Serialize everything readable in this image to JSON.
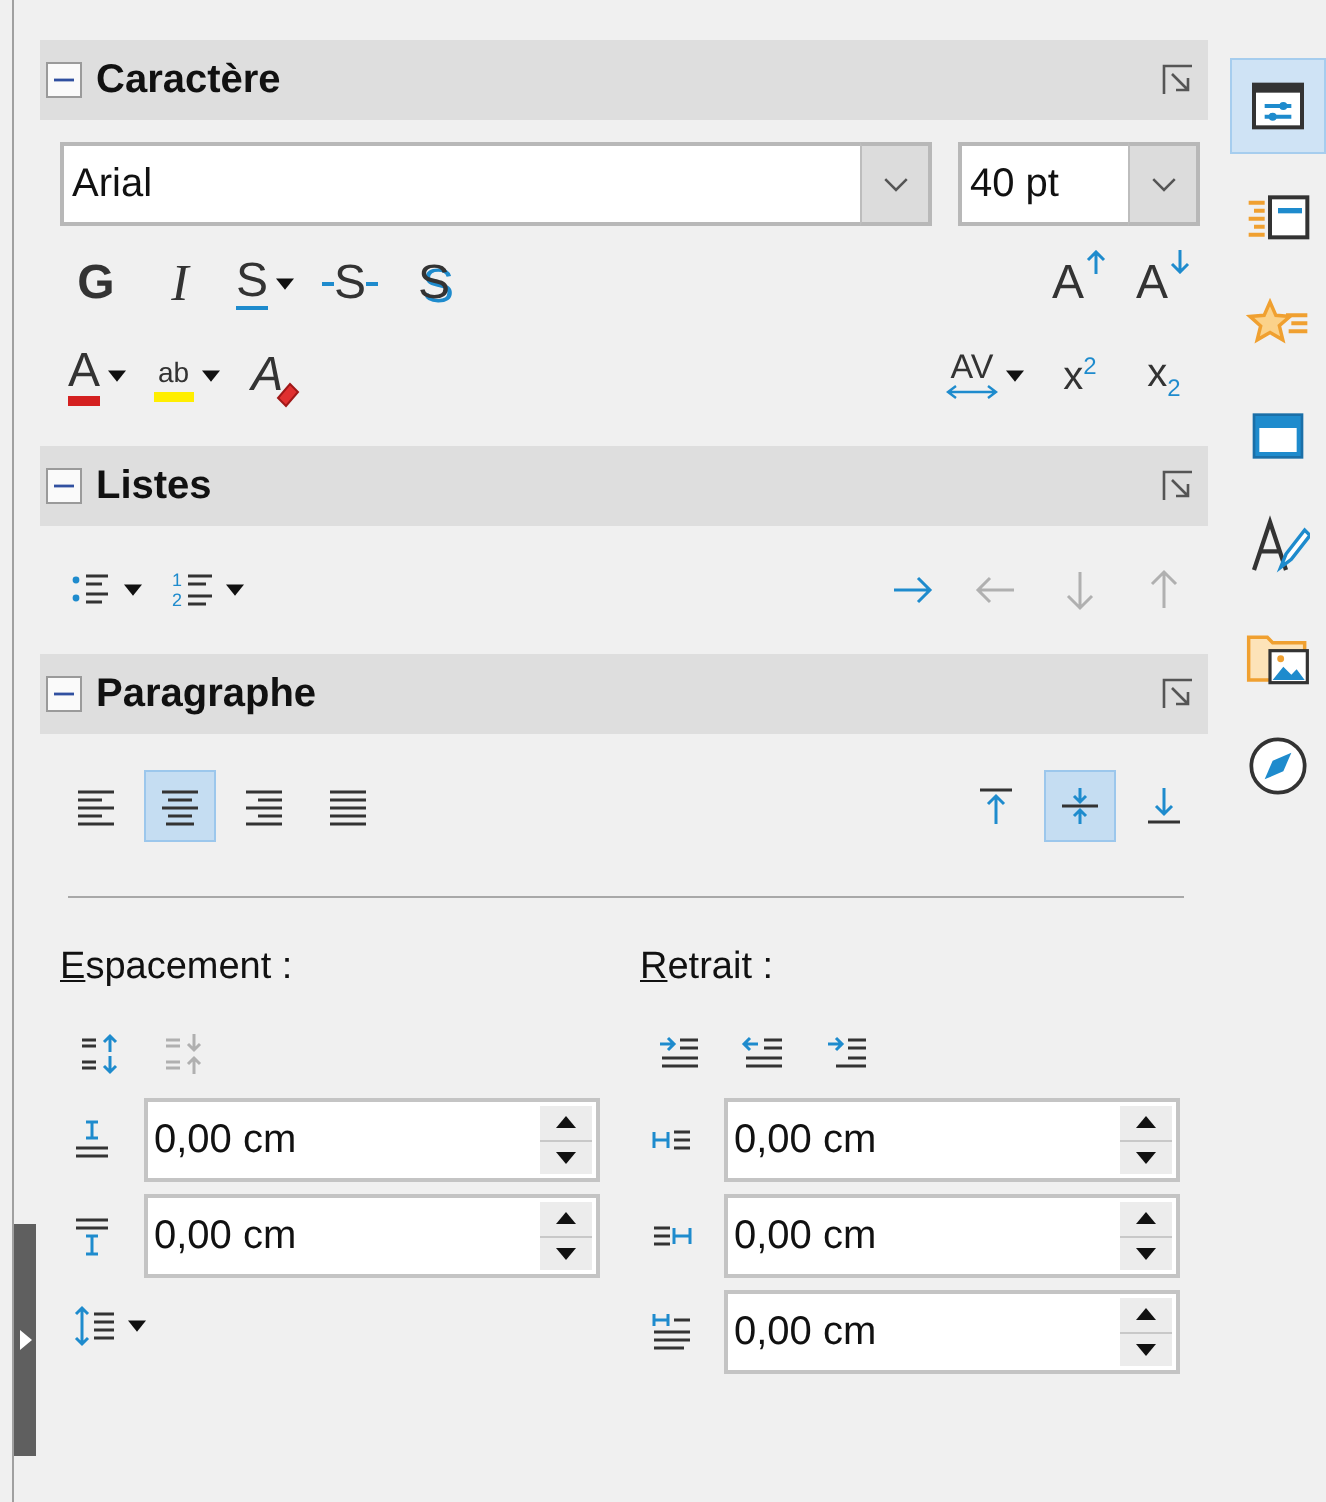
{
  "character": {
    "title": "Caractère",
    "expanded": true,
    "font_name": {
      "value": "Arial"
    },
    "font_size": {
      "value": "40 pt"
    },
    "format_tools": [
      {
        "kind": "bold",
        "label": "G"
      },
      {
        "kind": "italic",
        "label": "I"
      },
      {
        "kind": "underline",
        "label": "S",
        "dropdown": true
      },
      {
        "kind": "strikethrough",
        "label": "S"
      },
      {
        "kind": "shadow",
        "label": "S"
      }
    ],
    "size_tools": [
      {
        "kind": "grow",
        "label": "A"
      },
      {
        "kind": "shrink",
        "label": "A"
      }
    ],
    "color_tools": [
      {
        "kind": "font_color",
        "label": "A",
        "dropdown": true
      },
      {
        "kind": "highlight",
        "label": "ab",
        "dropdown": true
      },
      {
        "kind": "clear",
        "label": "A"
      }
    ],
    "position_tools": [
      {
        "kind": "char_spacing",
        "label": "AV",
        "dropdown": true
      },
      {
        "kind": "superscript",
        "label": "x$^{2}$"
      },
      {
        "kind": "subscript",
        "label": "x$_{2}$"
      }
    ]
  },
  "lists": {
    "title": "Listes",
    "expanded": true,
    "list_tools": [
      {
        "kind": "bullets",
        "dropdown": true
      },
      {
        "kind": "numbering",
        "digits": [
          "1",
          "2"
        ],
        "dropdown": true
      }
    ],
    "outline_tools": [
      {
        "kind": "right",
        "disabled": false
      },
      {
        "kind": "left",
        "disabled": true
      },
      {
        "kind": "down",
        "disabled": true
      },
      {
        "kind": "up",
        "disabled": true
      }
    ]
  },
  "paragraph": {
    "title": "Paragraphe",
    "expanded": true,
    "align_tools": [
      {
        "kind": "align_left",
        "selected": false
      },
      {
        "kind": "align_center",
        "selected": true
      },
      {
        "kind": "align_right",
        "selected": false
      },
      {
        "kind": "justify",
        "selected": false
      }
    ],
    "valign_tools": [
      {
        "kind": "top",
        "selected": false
      },
      {
        "kind": "center",
        "selected": true
      },
      {
        "kind": "bottom",
        "selected": false
      }
    ],
    "spacing": {
      "label": "Espacement :",
      "tools": [
        {
          "kind": "increase",
          "disabled": false
        },
        {
          "kind": "decrease",
          "disabled": true
        }
      ],
      "fields": [
        {
          "kind": "above",
          "value": "0,00 cm"
        },
        {
          "kind": "below",
          "value": "0,00 cm"
        }
      ],
      "line_spacing": {
        "dropdown": true
      }
    },
    "indent": {
      "label": "Retrait :",
      "tools": [
        {
          "kind": "increase"
        },
        {
          "kind": "decrease"
        },
        {
          "kind": "hanging"
        }
      ],
      "fields": [
        {
          "kind": "before",
          "value": "0,00 cm"
        },
        {
          "kind": "after",
          "value": "0,00 cm"
        },
        {
          "kind": "first_line",
          "value": "0,00 cm"
        }
      ]
    }
  },
  "side_tabs": [
    {
      "kind": "properties",
      "selected": true
    },
    {
      "kind": "lines_panel",
      "selected": false
    },
    {
      "kind": "star",
      "selected": false
    },
    {
      "kind": "panel",
      "selected": false
    },
    {
      "kind": "letter_brush",
      "selected": false
    },
    {
      "kind": "folder_image",
      "selected": false
    },
    {
      "kind": "compass",
      "selected": false
    }
  ]
}
